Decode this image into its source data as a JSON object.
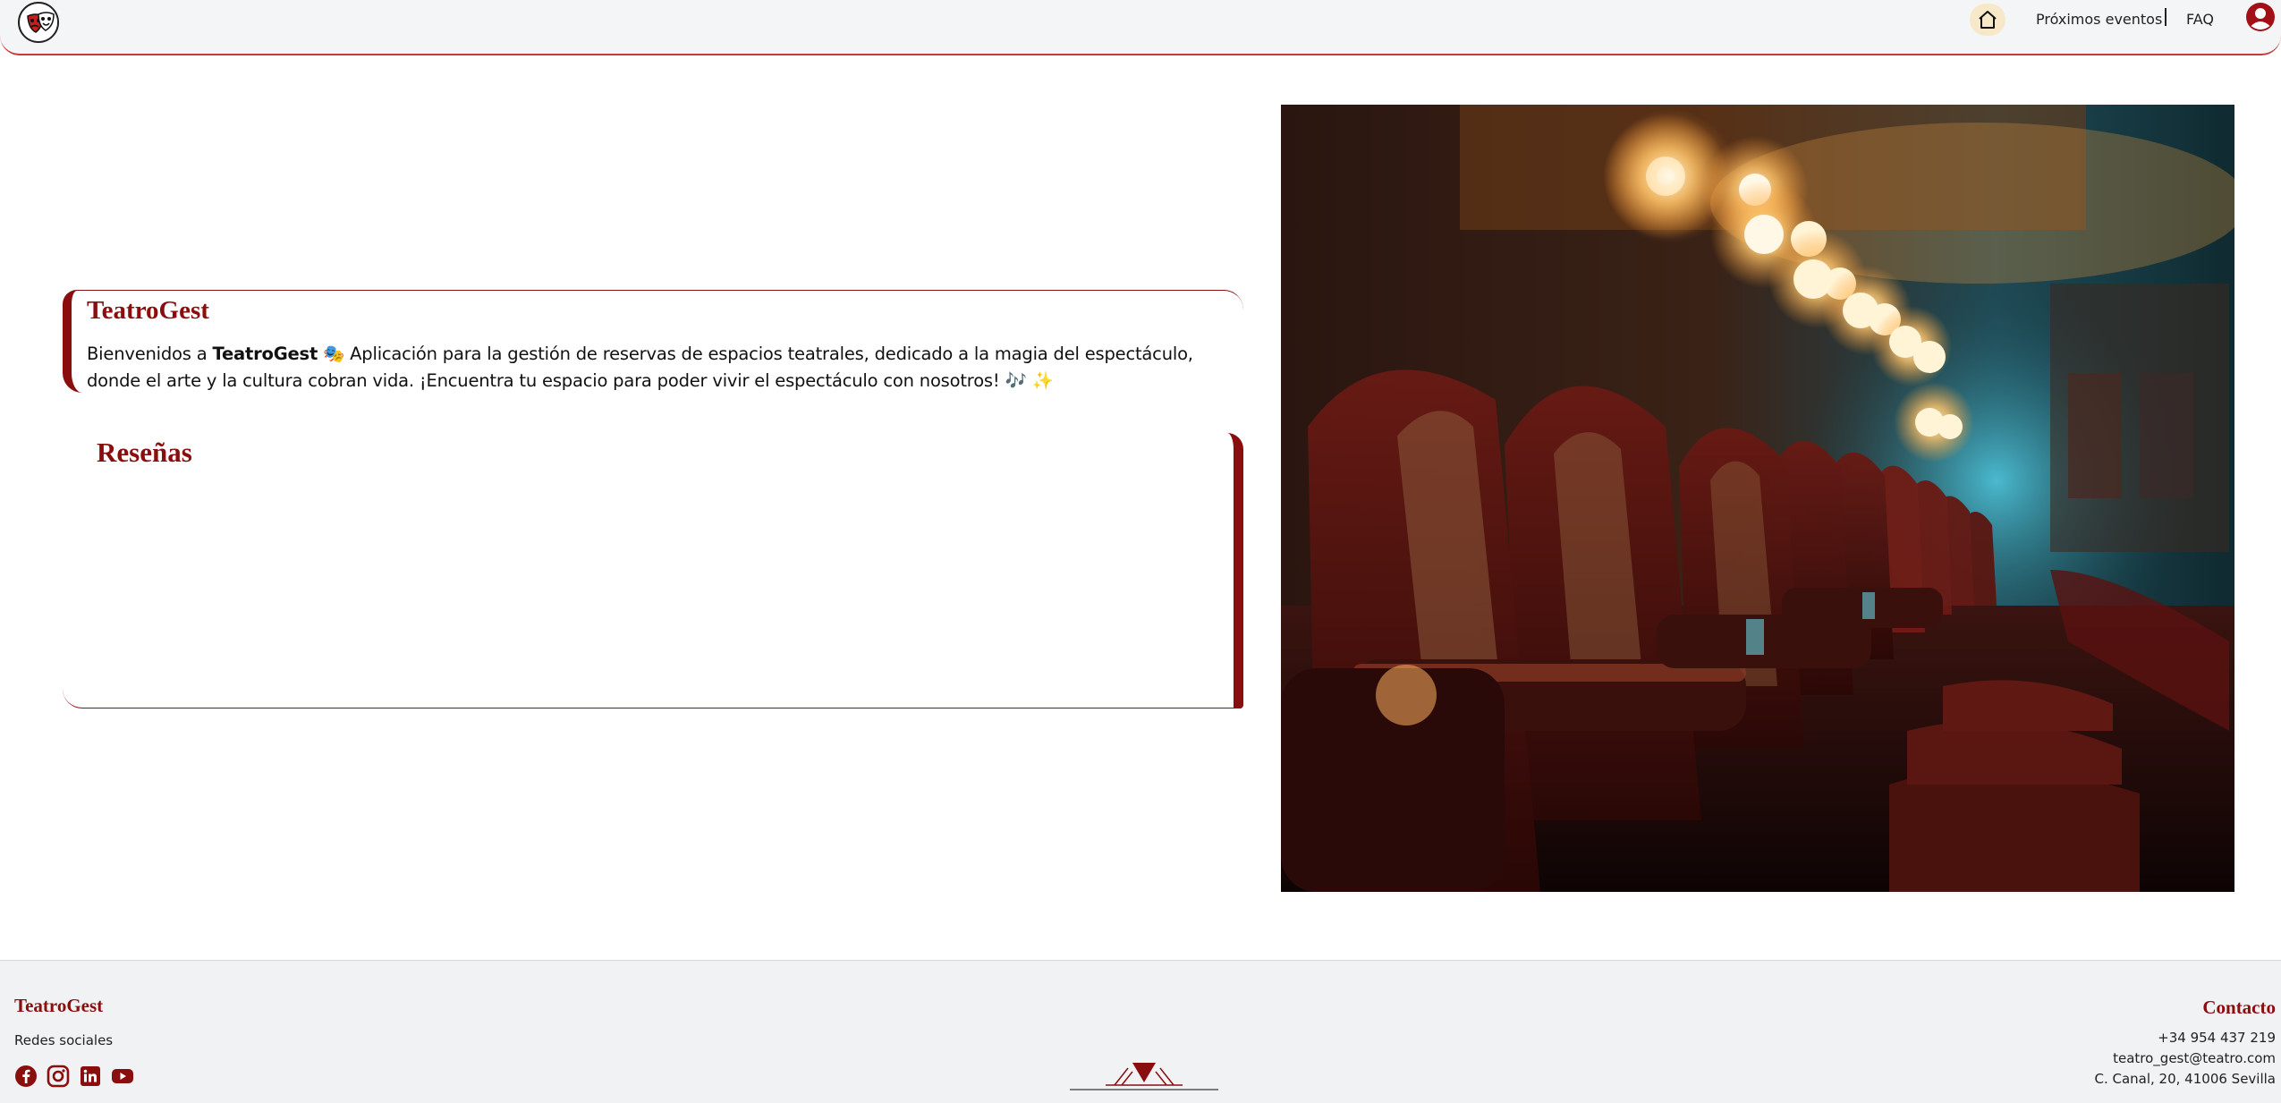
{
  "header": {
    "nav": {
      "home_icon": "home-icon",
      "upcoming": "Próximos eventos",
      "faq": "FAQ",
      "user_icon": "user-circle-icon"
    },
    "colors": {
      "brand": "#8b0e0e",
      "accent_border": "#c53a3a",
      "home_bg": "#f6e8c8"
    }
  },
  "hero": {
    "title": "TeatroGest",
    "text_before": "Bienvenidos a ",
    "text_brand": "TeatroGest",
    "text_after": " 🎭 Aplicación para la gestión de reservas de espacios teatrales, dedicado a la magia del espectáculo, donde el arte y la cultura cobran vida. ¡Encuentra tu espacio para poder vivir el espectáculo con nosotros! 🎶 ✨"
  },
  "reviews": {
    "title": "Reseñas"
  },
  "footer": {
    "brand": "TeatroGest",
    "social_label": "Redes sociales",
    "social_icons": [
      "facebook-icon",
      "instagram-icon",
      "linkedin-icon",
      "youtube-icon"
    ],
    "contact_title": "Contacto",
    "phone": "+34 954 437 219",
    "email": "teatro_gest@teatro.com",
    "address": "C. Canal, 20, 41006 Sevilla"
  }
}
